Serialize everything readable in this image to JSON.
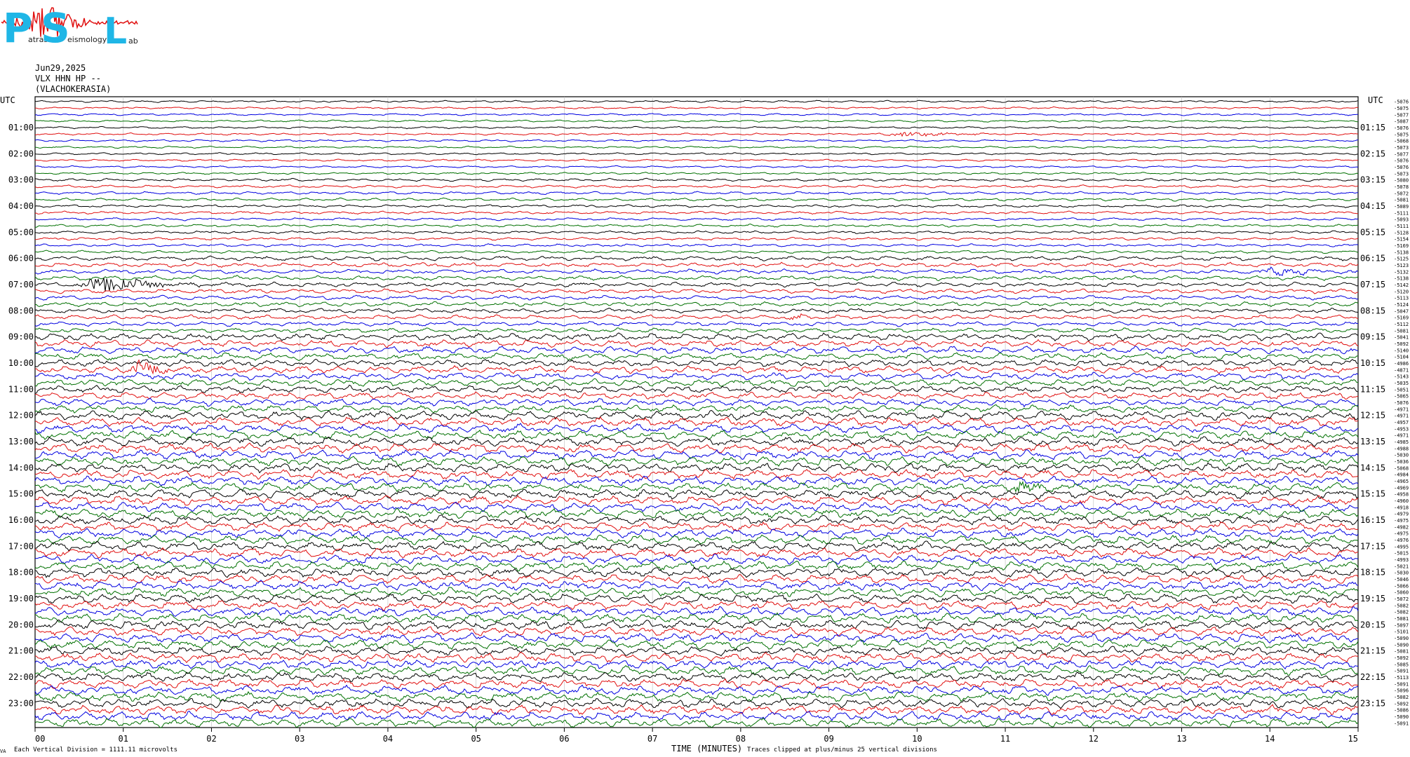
{
  "logo": {
    "letters": [
      "P",
      "S",
      "L"
    ],
    "words": [
      "atras",
      "eismology",
      "ab"
    ],
    "colors": {
      "letters": "#1fb6e6",
      "wave": "#e01010"
    }
  },
  "header": {
    "date": "Jun29,2025",
    "station": "VLX HHN HP --",
    "location": "(VLACHOKERASIA)"
  },
  "axes": {
    "left_title": "UTC",
    "right_title": "UTC",
    "xlabel": "TIME (MINUTES)",
    "xticks": [
      "00",
      "01",
      "02",
      "03",
      "04",
      "05",
      "06",
      "07",
      "08",
      "09",
      "10",
      "11",
      "12",
      "13",
      "14",
      "15"
    ]
  },
  "footer": {
    "corner_mark": "VA",
    "scale_note": "Each Vertical Division = 1111.11 microvolts",
    "clip_note": "Traces clipped at plus/minus 25 vertical divisions"
  },
  "chart_data": {
    "type": "line",
    "title": "",
    "xlabel": "TIME (MINUTES)",
    "ylabel": "UTC",
    "xlim": [
      0,
      15
    ],
    "trace_count": 96,
    "minutes_per_trace": 15,
    "color_cycle": [
      "#000000",
      "#e01010",
      "#0000e0",
      "#007000"
    ],
    "left_labels": [
      "01:00",
      "02:00",
      "03:00",
      "04:00",
      "05:00",
      "06:00",
      "07:00",
      "08:00",
      "09:00",
      "10:00",
      "11:00",
      "12:00",
      "13:00",
      "14:00",
      "15:00",
      "16:00",
      "17:00",
      "18:00",
      "19:00",
      "20:00",
      "21:00",
      "22:00",
      "23:00"
    ],
    "right_labels": [
      "01:15",
      "02:15",
      "03:15",
      "04:15",
      "05:15",
      "06:15",
      "07:15",
      "08:15",
      "09:15",
      "10:15",
      "11:15",
      "12:15",
      "13:15",
      "14:15",
      "15:15",
      "16:15",
      "17:15",
      "18:15",
      "19:15",
      "20:15",
      "21:15",
      "22:15",
      "23:15"
    ],
    "trace_means": [
      "-5076",
      "-5075",
      "-5077",
      "-5087",
      "-5076",
      "-5075",
      "-5068",
      "-5073",
      "-5077",
      "-5076",
      "-5076",
      "-5073",
      "-5080",
      "-5078",
      "-5072",
      "-5081",
      "-5089",
      "-5111",
      "-5093",
      "-5111",
      "-5128",
      "-5154",
      "-5169",
      "-5138",
      "-5125",
      "-5123",
      "-5132",
      "-5138",
      "-5142",
      "-5120",
      "-5113",
      "-5124",
      "-5047",
      "-5169",
      "-5112",
      "-5081",
      "-5041",
      "-5092",
      "-5140",
      "-5104",
      "-4986",
      "-4871",
      "-5143",
      "-5035",
      "-5051",
      "-5065",
      "-5076",
      "-4971",
      "-4971",
      "-4957",
      "-4953",
      "-4971",
      "-4985",
      "-4988",
      "-5030",
      "-5036",
      "-5068",
      "-4984",
      "-4965",
      "-4969",
      "-4958",
      "-4960",
      "-4918",
      "-4979",
      "-4975",
      "-4982",
      "-4975",
      "-4976",
      "-4995",
      "-5015",
      "-4993",
      "-5021",
      "-5030",
      "-5046",
      "-5066",
      "-5060",
      "-5072",
      "-5082",
      "-5082",
      "-5081",
      "-5097",
      "-5101",
      "-5090",
      "-5090",
      "-5081",
      "-5092",
      "-5085",
      "-5091",
      "-5113",
      "-5091",
      "-5096",
      "-5082",
      "-5092",
      "-5086",
      "-5090",
      "-5091"
    ],
    "amplitude_profile": [
      {
        "from_trace": 0,
        "to_trace": 12,
        "level": 1.2
      },
      {
        "from_trace": 12,
        "to_trace": 24,
        "level": 1.6
      },
      {
        "from_trace": 24,
        "to_trace": 36,
        "level": 2.6
      },
      {
        "from_trace": 36,
        "to_trace": 48,
        "level": 4.0
      },
      {
        "from_trace": 48,
        "to_trace": 96,
        "level": 5.0
      }
    ],
    "events": [
      {
        "trace": 28,
        "minute": 0.8,
        "duration_min": 1.4,
        "amplitude": 10
      },
      {
        "trace": 26,
        "minute": 14.1,
        "duration_min": 0.9,
        "amplitude": 8
      },
      {
        "trace": 5,
        "minute": 9.9,
        "duration_min": 1.4,
        "amplitude": 3
      },
      {
        "trace": 41,
        "minute": 1.2,
        "duration_min": 0.7,
        "amplitude": 12
      },
      {
        "trace": 59,
        "minute": 11.2,
        "duration_min": 0.5,
        "amplitude": 9
      },
      {
        "trace": 85,
        "minute": 0.3,
        "duration_min": 0.5,
        "amplitude": 3
      },
      {
        "trace": 33,
        "minute": 8.6,
        "duration_min": 0.3,
        "amplitude": 4
      }
    ]
  }
}
